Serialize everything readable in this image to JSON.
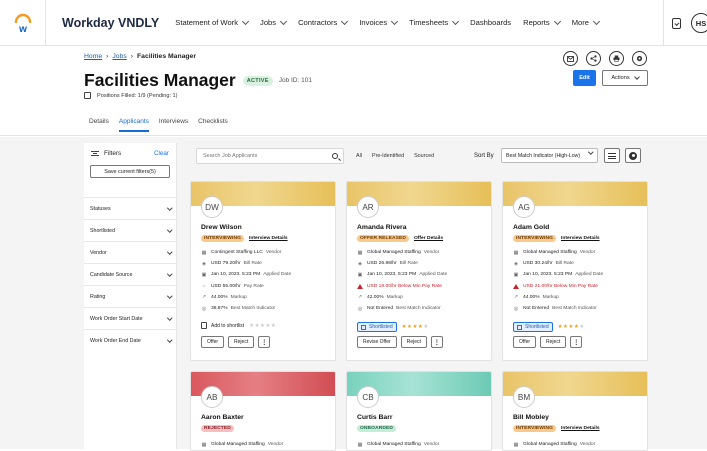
{
  "app": {
    "brand": "Workday VNDLY",
    "user_initials": "HS"
  },
  "nav": [
    {
      "label": "Statement of Work"
    },
    {
      "label": "Jobs"
    },
    {
      "label": "Contractors"
    },
    {
      "label": "Invoices"
    },
    {
      "label": "Timesheets"
    },
    {
      "label": "Dashboards"
    },
    {
      "label": "Reports"
    },
    {
      "label": "More"
    }
  ],
  "nav_dropdown": [
    true,
    true,
    true,
    true,
    true,
    false,
    true,
    true
  ],
  "breadcrumb": {
    "home": "Home",
    "jobs": "Jobs",
    "current": "Facilities Manager",
    "sep": "›"
  },
  "job": {
    "title": "Facilities Manager",
    "status": "ACTIVE",
    "job_id": "Job ID: 101",
    "positions": "Positions Filled: 1/9 (Pending: 1)"
  },
  "header_buttons": {
    "edit": "Edit",
    "actions": "Actions"
  },
  "tabs": [
    "Details",
    "Applicants",
    "Interviews",
    "Checklists"
  ],
  "active_tab": 1,
  "filters": {
    "title": "Filters",
    "clear": "Clear",
    "save": "Save current filters(5)",
    "items": [
      "Statuses",
      "Shortlisted",
      "Vendor",
      "Candidate Source",
      "Rating",
      "Work Order Start Date",
      "Work Order End Date"
    ]
  },
  "toolbar": {
    "search_placeholder": "Search Job Applicants",
    "pills": [
      "All",
      "Pre-Identified",
      "Sourced"
    ],
    "sort_label": "Sort By",
    "sort_value": "Best Match Indicator (High-Low)"
  },
  "cards": [
    {
      "initials": "DW",
      "name": "Drew Wilson",
      "status": "INTERVIEWING",
      "status_link": "Interview Details",
      "vendor": "Contingent Staffing LLC",
      "vendor_lbl": "Vendor",
      "bill": "USD 79.20/hr",
      "bill_lbl": "Bill Rate",
      "date": "Jan 10, 2023, 5:23 PM",
      "date_lbl": "Applied Date",
      "pay": "USD 55.00/hr",
      "pay_lbl": "Pay Rate",
      "markup": "44.00%",
      "markup_lbl": "Markup",
      "match": "38.87%",
      "match_lbl": "Best Match Indicator",
      "shortlist": "Add to shortlist",
      "rating": 0,
      "buttons": [
        "Offer",
        "Reject"
      ]
    },
    {
      "initials": "AR",
      "name": "Amanda Rivera",
      "status": "OFFER RELEASED",
      "status_link": "Offer Details",
      "vendor": "Global Managed Staffing",
      "vendor_lbl": "Vendor",
      "bill": "USD 26.98/hr",
      "bill_lbl": "Bill Rate",
      "date": "Jan 10, 2023, 5:23 PM",
      "date_lbl": "Applied Date",
      "pay": "USD 19.00/hr Below Min Pay Rate",
      "pay_lbl": "",
      "markup": "42.00%",
      "markup_lbl": "Markup",
      "match": "Not Entered",
      "match_lbl": "Best Match Indicator",
      "shortlist": "Shortlisted",
      "rating": 4,
      "buttons": [
        "Revise Offer",
        "Reject"
      ]
    },
    {
      "initials": "AG",
      "name": "Adam Gold",
      "status": "INTERVIEWING",
      "status_link": "Interview Details",
      "vendor": "Global Managed Staffing",
      "vendor_lbl": "Vendor",
      "bill": "USD 30.24/hr",
      "bill_lbl": "Bill Rate",
      "date": "Jan 10, 2023, 5:23 PM",
      "date_lbl": "Applied Date",
      "pay": "USD 21.00/hr Below Min Pay Rate",
      "pay_lbl": "",
      "markup": "44.00%",
      "markup_lbl": "Markup",
      "match": "Not Entered",
      "match_lbl": "Best Match Indicator",
      "shortlist": "Shortlisted",
      "rating": 4,
      "buttons": [
        "Offer",
        "Reject"
      ]
    },
    {
      "initials": "AB",
      "name": "Aaron Baxter",
      "status": "REJECTED",
      "status_link": "",
      "vendor": "Global Managed Staffing",
      "vendor_lbl": "Vendor"
    },
    {
      "initials": "CB",
      "name": "Curtis Barr",
      "status": "ONBOARDED",
      "status_link": "",
      "vendor": "Global Managed Staffing",
      "vendor_lbl": "Vendor"
    },
    {
      "initials": "BM",
      "name": "Bill Mobley",
      "status": "INTERVIEWING",
      "status_link": "Interview Details",
      "vendor": "Global Managed Staffing",
      "vendor_lbl": "Vendor"
    }
  ],
  "colors": {
    "accent": "#1a73e8",
    "warn": "#c4242b",
    "star": "#e7a623"
  }
}
